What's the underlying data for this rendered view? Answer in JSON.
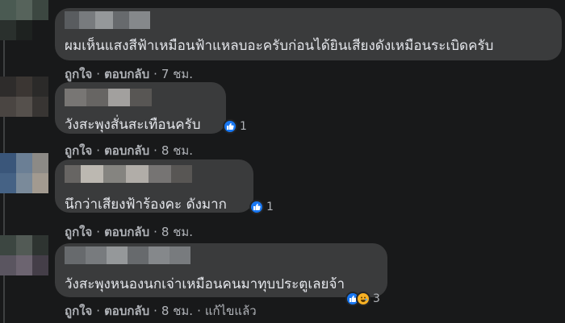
{
  "comments": [
    {
      "text": "ผมเห็นแสงสีฟ้าเหมือนฟ้าแหลบอะครับก่อนได้ยินเสียงดังเหมือนระเบิดครับ",
      "like_label": "ถูกใจ",
      "reply_label": "ตอบกลับ",
      "time": "7 ชม.",
      "separator": "·"
    },
    {
      "text": "วังสะพุงสั่นสะเทือนครับ",
      "like_label": "ถูกใจ",
      "reply_label": "ตอบกลับ",
      "time": "8 ชม.",
      "separator": "·",
      "reaction_count": "1",
      "reaction_icons": [
        "like-icon"
      ]
    },
    {
      "text": "นึกว่าเสียงฟ้าร้องคะ ดังมาก",
      "like_label": "ถูกใจ",
      "reply_label": "ตอบกลับ",
      "time": "8 ชม.",
      "separator": "·",
      "reaction_count": "1",
      "reaction_icons": [
        "like-icon"
      ]
    },
    {
      "text": "วังสะพุงหนองนกเจ่าเหมือนคนมาทุบประตูเลยจ้า",
      "like_label": "ถูกใจ",
      "reply_label": "ตอบกลับ",
      "time": "8 ชม.",
      "separator": "·",
      "edited": "แก้ไขแล้ว",
      "reaction_count": "3",
      "reaction_icons": [
        "like-icon",
        "haha-icon"
      ]
    }
  ],
  "colors": {
    "background": "#18191a",
    "bubble": "#3a3b3c",
    "text": "#e4e6eb",
    "secondary": "#b0b3b8",
    "like": "#1877f2",
    "haha": "#f7b125"
  }
}
